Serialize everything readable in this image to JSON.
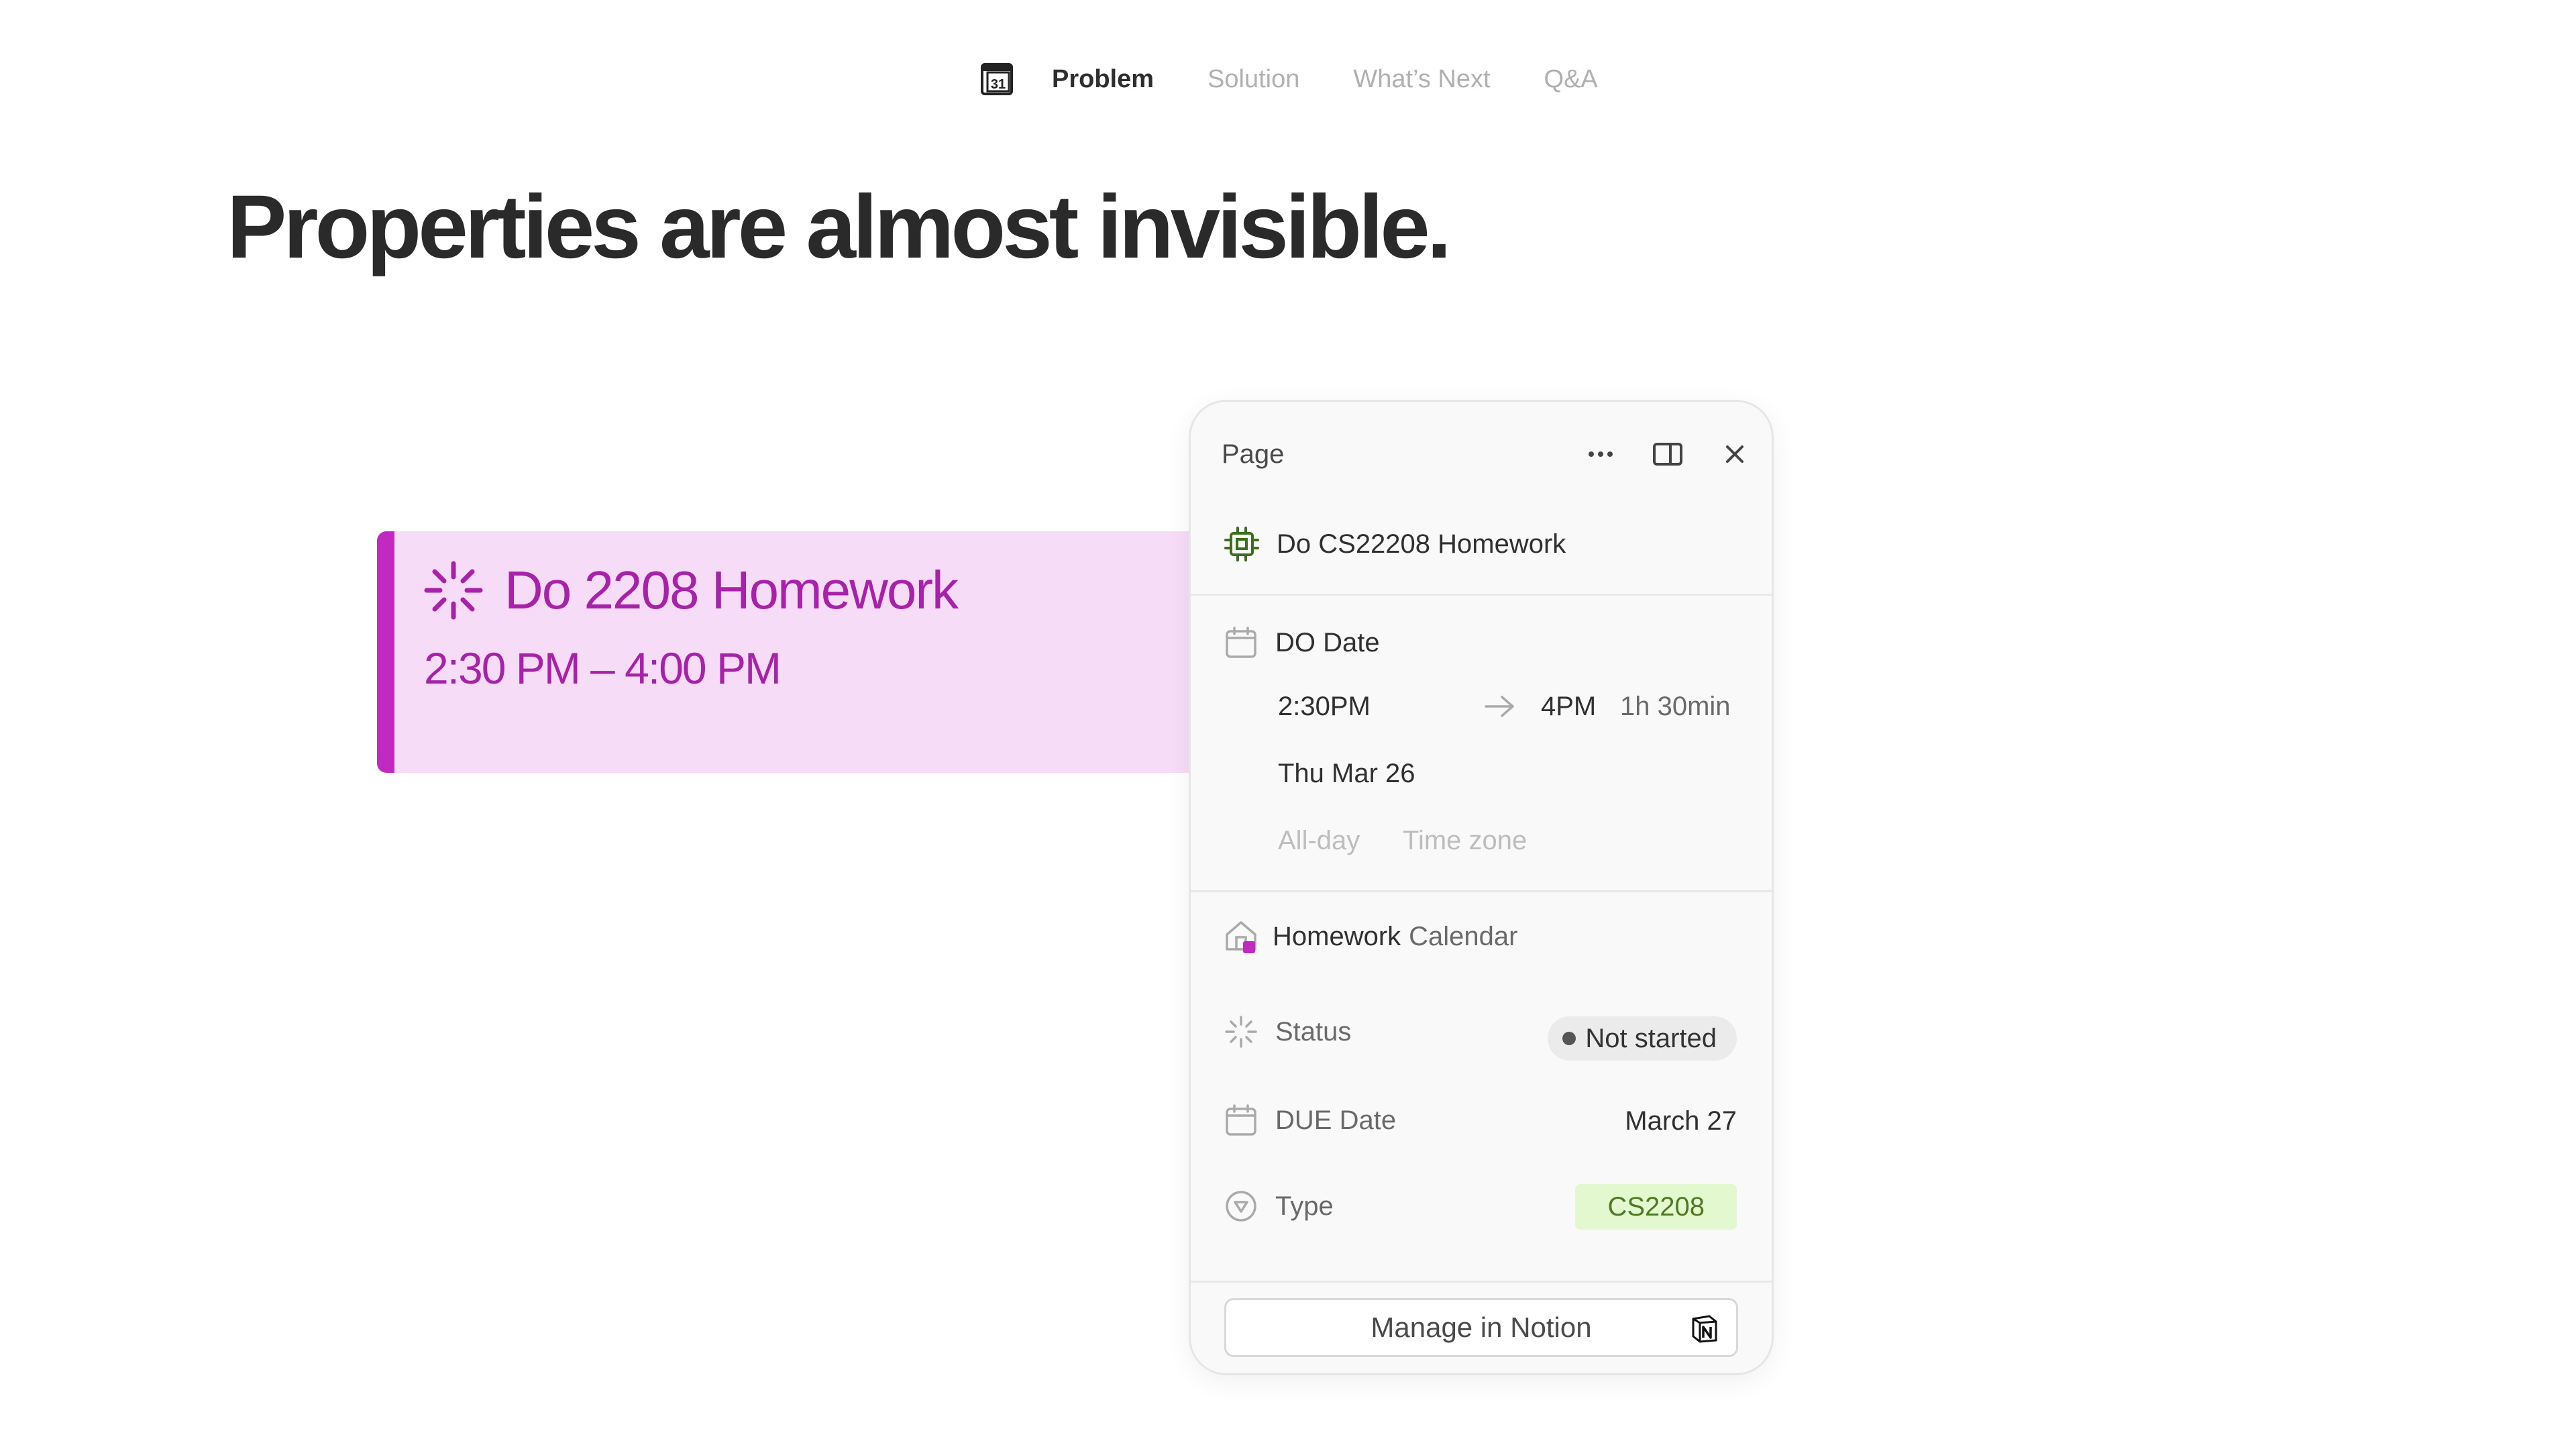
{
  "nav": {
    "logo_icon": "calendar-31-icon",
    "tabs": [
      {
        "label": "Problem",
        "active": true
      },
      {
        "label": "Solution",
        "active": false
      },
      {
        "label": "What’s Next",
        "active": false
      },
      {
        "label": "Q&A",
        "active": false
      }
    ]
  },
  "headline": "Properties are almost invisible.",
  "event": {
    "title": "Do 2208 Homework",
    "time": "2:30 PM – 4:00 PM",
    "color": "#a622a8",
    "bar_color": "#c02ac0",
    "background": "#f7dcf7"
  },
  "panel": {
    "header_label": "Page",
    "page_title": "Do CS22208 Homework",
    "do_date": {
      "label": "DO Date",
      "start_time": "2:30PM",
      "end_time": "4PM",
      "duration": "1h 30min",
      "day": "Thu Mar 26",
      "all_day": "All-day",
      "time_zone": "Time zone"
    },
    "calendar": {
      "name_primary": "Homework",
      "name_secondary": "Calendar"
    },
    "properties": {
      "status": {
        "label": "Status",
        "value": "Not started"
      },
      "due_date": {
        "label": "DUE Date",
        "value": "March 27"
      },
      "type": {
        "label": "Type",
        "value": "CS2208"
      }
    },
    "manage_button": "Manage in Notion"
  }
}
